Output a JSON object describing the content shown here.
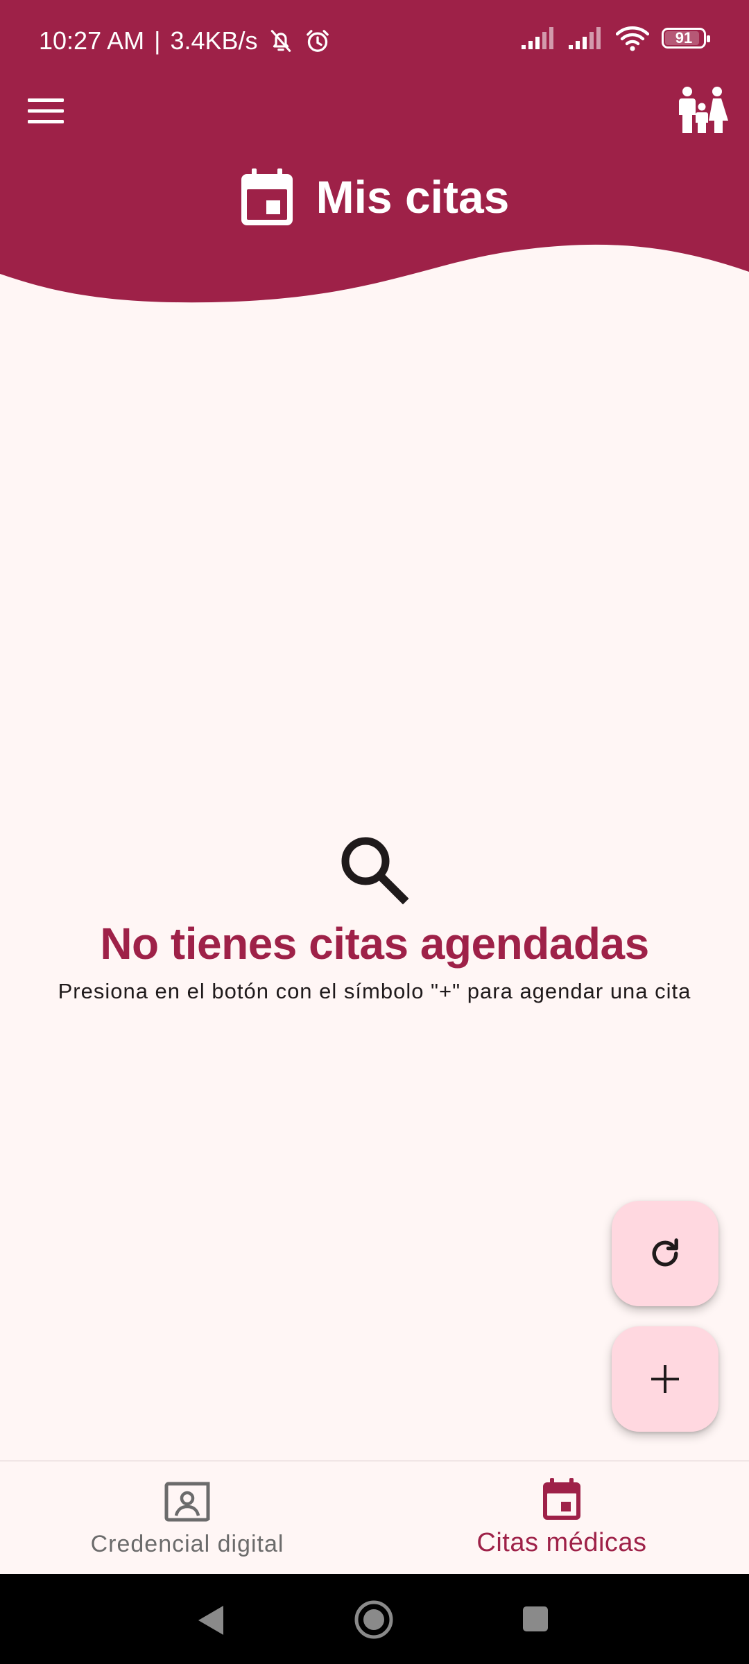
{
  "status_bar": {
    "time": "10:27 AM",
    "separator": "|",
    "speed": "3.4KB/s",
    "battery": "91",
    "battery_level": 0.91
  },
  "header": {
    "title": "Mis citas",
    "menu_icon": "menu-icon",
    "family_icon": "family-icon",
    "title_icon": "calendar-icon"
  },
  "empty_state": {
    "icon": "search-icon",
    "title": "No tienes citas agendadas",
    "subtitle": "Presiona en el botón con el símbolo \"+\" para agendar una cita"
  },
  "fabs": {
    "refresh_icon": "refresh-icon",
    "add_icon": "plus-icon"
  },
  "bottom_nav": {
    "items": [
      {
        "label": "Credencial digital",
        "icon": "id-card-icon",
        "active": false
      },
      {
        "label": "Citas médicas",
        "icon": "calendar-icon",
        "active": true
      }
    ]
  },
  "colors": {
    "primary": "#9E2148",
    "background": "#FFF6F5",
    "fab": "#FFD8E0",
    "inactive": "#6b6b6b"
  }
}
